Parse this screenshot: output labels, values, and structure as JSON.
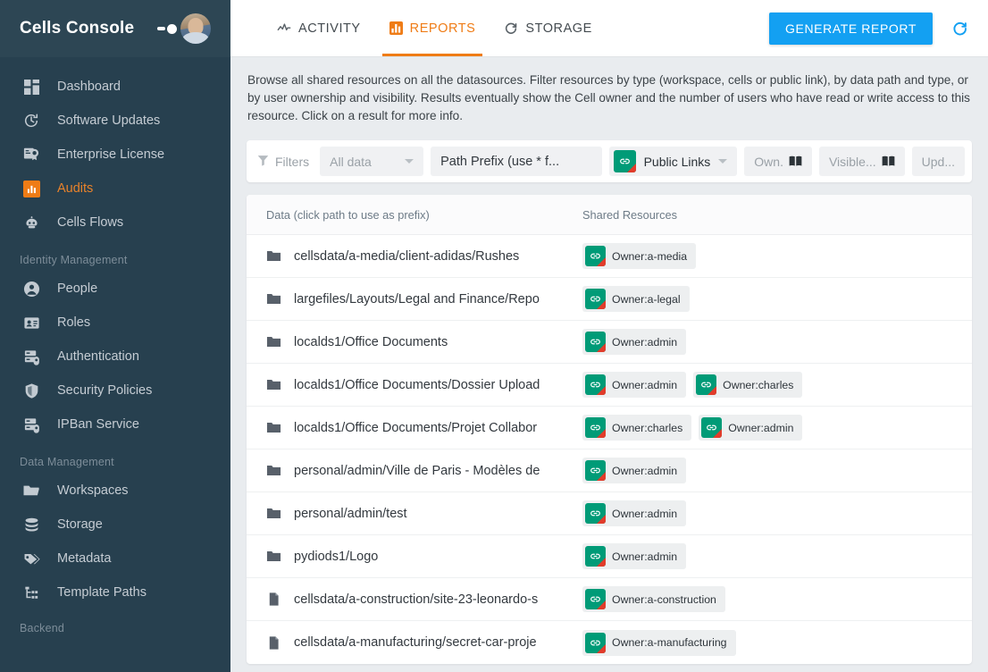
{
  "brand": {
    "title": "Cells Console",
    "toggle_icon": "toggle-switch-icon",
    "avatar_icon": "user-avatar"
  },
  "sidebar": {
    "groups": [
      {
        "label": "",
        "items": [
          {
            "label": "Dashboard",
            "icon": "dashboard-grid-icon",
            "active": false
          },
          {
            "label": "Software Updates",
            "icon": "update-clock-icon",
            "active": false
          },
          {
            "label": "Enterprise License",
            "icon": "license-certificate-icon",
            "active": false
          },
          {
            "label": "Audits",
            "icon": "bar-chart-icon",
            "active": true
          },
          {
            "label": "Cells Flows",
            "icon": "robot-icon",
            "active": false
          }
        ]
      },
      {
        "label": "Identity Management",
        "items": [
          {
            "label": "People",
            "icon": "person-icon",
            "active": false
          },
          {
            "label": "Roles",
            "icon": "id-card-icon",
            "active": false
          },
          {
            "label": "Authentication",
            "icon": "server-lock-icon",
            "active": false
          },
          {
            "label": "Security Policies",
            "icon": "shield-icon",
            "active": false
          },
          {
            "label": "IPBan Service",
            "icon": "server-lock-icon",
            "active": false
          }
        ]
      },
      {
        "label": "Data Management",
        "items": [
          {
            "label": "Workspaces",
            "icon": "folder-icon",
            "active": false
          },
          {
            "label": "Storage",
            "icon": "database-icon",
            "active": false
          },
          {
            "label": "Metadata",
            "icon": "tags-icon",
            "active": false
          },
          {
            "label": "Template Paths",
            "icon": "tree-path-icon",
            "active": false
          }
        ]
      },
      {
        "label": "Backend",
        "items": []
      }
    ]
  },
  "topbar": {
    "tabs": [
      {
        "label": "ACTIVITY",
        "icon": "activity-pulse-icon",
        "active": false
      },
      {
        "label": "REPORTS",
        "icon": "bar-chart-icon",
        "active": true
      },
      {
        "label": "STORAGE",
        "icon": "refresh-circle-icon",
        "active": false
      }
    ],
    "generate_report_label": "GENERATE REPORT",
    "refresh_icon": "refresh-rotate-icon"
  },
  "content": {
    "description": "Browse all shared resources on all the datasources. Filter resources by type (workspace, cells or public link), by data path and type, or by user ownership and visibility. Results eventually show the Cell owner and the number of users who have read or write access to this resource. Click on a result for more info."
  },
  "filters": {
    "label": "Filters",
    "filter_icon": "funnel-icon",
    "scope_select": {
      "value": "All data",
      "caret_icon": "chevron-down-icon"
    },
    "path_prefix": {
      "placeholder": "Path Prefix (use * f..."
    },
    "type_select": {
      "value": "Public Links",
      "icon": "link-badge-icon",
      "caret_icon": "chevron-down-icon"
    },
    "owner": {
      "value": "Own.",
      "icon": "book-icon"
    },
    "visible": {
      "value": "Visible...",
      "icon": "book-icon"
    },
    "updated": {
      "value": "Upd..."
    }
  },
  "table": {
    "columns": [
      {
        "key": "data",
        "label": "Data (click path to use as prefix)"
      },
      {
        "key": "share",
        "label": "Shared Resources"
      }
    ],
    "rows": [
      {
        "type": "folder",
        "path": "cellsdata/a-media/client-adidas/Rushes",
        "resources": [
          {
            "label": "Owner:a-media"
          }
        ]
      },
      {
        "type": "folder",
        "path": "largefiles/Layouts/Legal and Finance/Repo",
        "resources": [
          {
            "label": "Owner:a-legal"
          }
        ]
      },
      {
        "type": "folder",
        "path": "localds1/Office Documents",
        "resources": [
          {
            "label": "Owner:admin"
          }
        ]
      },
      {
        "type": "folder",
        "path": "localds1/Office Documents/Dossier Upload",
        "resources": [
          {
            "label": "Owner:admin"
          },
          {
            "label": "Owner:charles"
          }
        ]
      },
      {
        "type": "folder",
        "path": "localds1/Office Documents/Projet Collabor",
        "resources": [
          {
            "label": "Owner:charles"
          },
          {
            "label": "Owner:admin"
          }
        ]
      },
      {
        "type": "folder",
        "path": "personal/admin/Ville de Paris - Modèles de",
        "resources": [
          {
            "label": "Owner:admin"
          }
        ]
      },
      {
        "type": "folder",
        "path": "personal/admin/test",
        "resources": [
          {
            "label": "Owner:admin"
          }
        ]
      },
      {
        "type": "folder",
        "path": "pydiods1/Logo",
        "resources": [
          {
            "label": "Owner:admin"
          }
        ]
      },
      {
        "type": "file",
        "path": "cellsdata/a-construction/site-23-leonardo-s",
        "resources": [
          {
            "label": "Owner:a-construction"
          }
        ]
      },
      {
        "type": "file",
        "path": "cellsdata/a-manufacturing/secret-car-proje",
        "resources": [
          {
            "label": "Owner:a-manufacturing"
          }
        ]
      }
    ]
  },
  "colors": {
    "sidebar_bg": "#27404f",
    "sidebar_header_bg": "#2d4654",
    "accent_orange": "#ef7c16",
    "accent_blue": "#13a0f2",
    "badge_teal": "#009b77",
    "badge_red": "#e23c2b",
    "content_bg": "#e9ecef"
  }
}
